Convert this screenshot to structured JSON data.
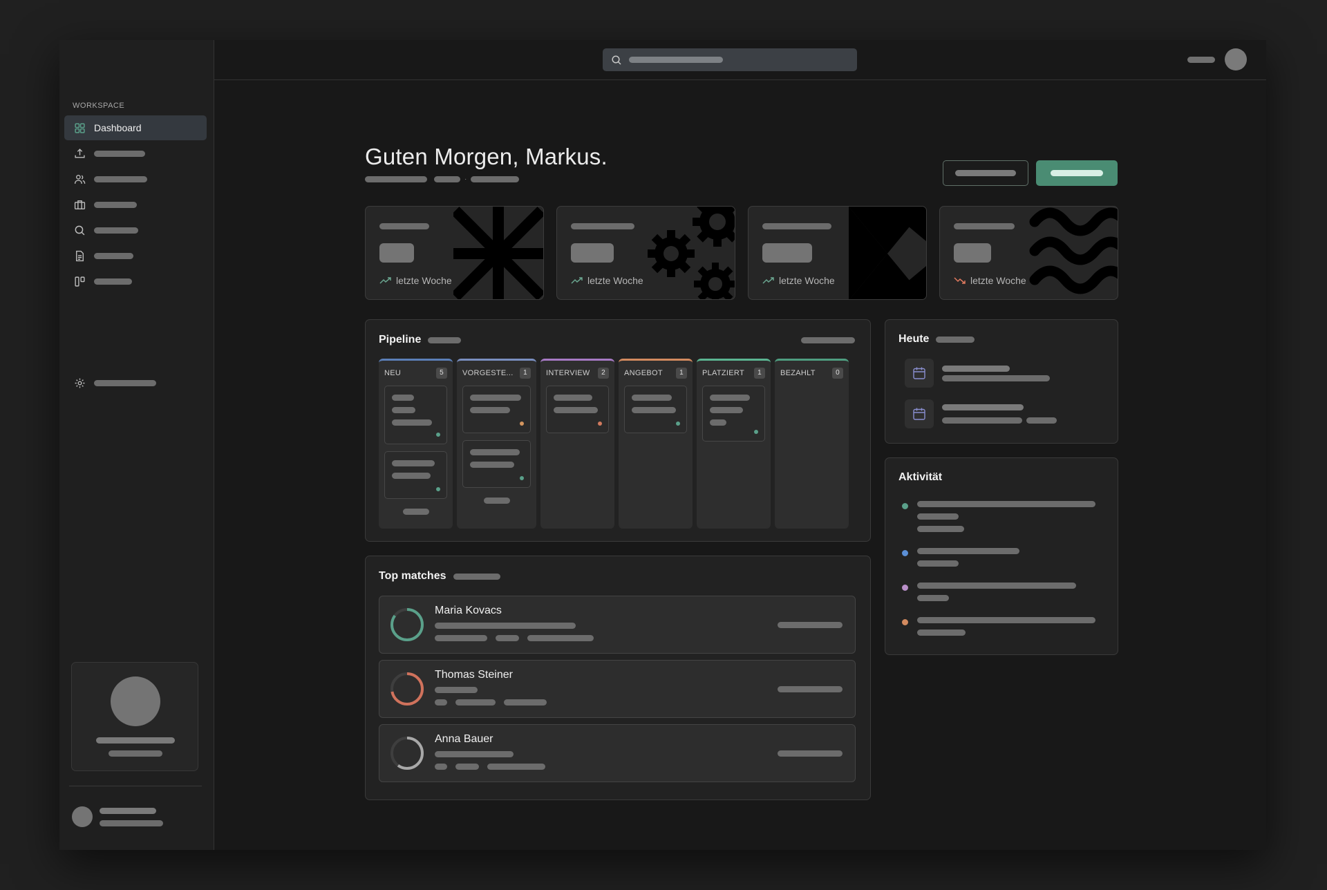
{
  "sidebar": {
    "section_label": "WORKSPACE",
    "items": [
      {
        "label": "Dashboard",
        "icon": "grid-icon",
        "active": true
      },
      {
        "label": "",
        "icon": "upload-icon"
      },
      {
        "label": "",
        "icon": "users-icon"
      },
      {
        "label": "",
        "icon": "briefcase-icon"
      },
      {
        "label": "",
        "icon": "search-icon"
      },
      {
        "label": "",
        "icon": "document-icon"
      },
      {
        "label": "",
        "icon": "kanban-icon"
      }
    ],
    "settings": {
      "label": "",
      "icon": "gear-icon"
    }
  },
  "header": {
    "greeting": "Guten Morgen, Markus.",
    "subtitle_separator": "·"
  },
  "stats": [
    {
      "trend_label": "letzte Woche",
      "trend": "up",
      "decoration": "asterisk"
    },
    {
      "trend_label": "letzte Woche",
      "trend": "up",
      "decoration": "gears"
    },
    {
      "trend_label": "letzte Woche",
      "trend": "up",
      "decoration": "triangles"
    },
    {
      "trend_label": "letzte Woche",
      "trend": "down",
      "decoration": "waves"
    }
  ],
  "pipeline": {
    "title": "Pipeline",
    "columns": [
      {
        "label": "NEU",
        "count": "5",
        "color": "#5b7fb8"
      },
      {
        "label": "VORGESTE...",
        "count": "1",
        "color": "#7a8fc0"
      },
      {
        "label": "INTERVIEW",
        "count": "2",
        "color": "#a77ac4"
      },
      {
        "label": "ANGEBOT",
        "count": "1",
        "color": "#d38a5f"
      },
      {
        "label": "PLATZIERT",
        "count": "1",
        "color": "#5bb592"
      },
      {
        "label": "BEZAHLT",
        "count": "0",
        "color": "#4f9e80"
      }
    ]
  },
  "top_matches": {
    "title": "Top matches",
    "items": [
      {
        "name": "Maria Kovacs",
        "color": "#5aa08a",
        "score": 0.85
      },
      {
        "name": "Thomas Steiner",
        "color": "#d0725c",
        "score": 0.72
      },
      {
        "name": "Anna Bauer",
        "color": "#a8a8a8",
        "score": 0.6
      }
    ]
  },
  "today": {
    "title": "Heute"
  },
  "activity": {
    "title": "Aktivität",
    "dot_colors": [
      "#5aa08a",
      "#5b8fd6",
      "#b98fc8",
      "#d38a5f"
    ]
  },
  "colors": {
    "accent": "#4a8c73",
    "up": "#6aa58f",
    "down": "#e07a5f"
  }
}
